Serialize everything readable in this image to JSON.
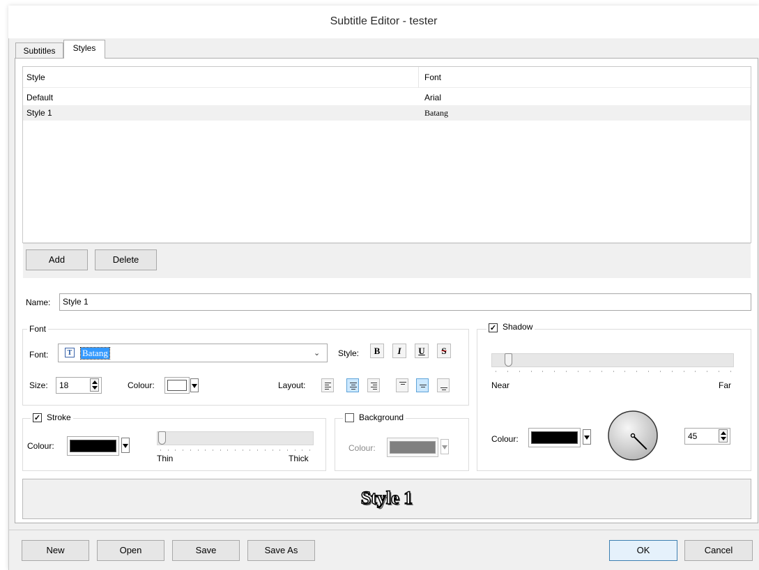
{
  "window": {
    "title": "Subtitle Editor - tester"
  },
  "tabs": [
    {
      "label": "Subtitles"
    },
    {
      "label": "Styles"
    }
  ],
  "styles_list": {
    "columns": [
      "Style",
      "Font"
    ],
    "rows": [
      {
        "style": "Default",
        "font": "Arial"
      },
      {
        "style": "Style 1",
        "font": "Batang"
      }
    ],
    "selected_row": 1
  },
  "list_buttons": {
    "add": "Add",
    "delete": "Delete"
  },
  "name": {
    "label": "Name:",
    "value": "Style 1"
  },
  "font_group": {
    "legend": "Font",
    "font_label": "Font:",
    "font_value": "Batang",
    "style_label": "Style:",
    "bold": "B",
    "italic": "I",
    "underline": "U",
    "strike": "S",
    "size_label": "Size:",
    "size_value": "18",
    "colour_label": "Colour:",
    "colour": "#ffffff",
    "layout_label": "Layout:"
  },
  "stroke_group": {
    "checked": true,
    "legend": "Stroke",
    "colour_label": "Colour:",
    "colour": "#000000",
    "slider_min": "Thin",
    "slider_max": "Thick",
    "slider_level": 0.0
  },
  "background_group": {
    "checked": false,
    "legend": "Background",
    "colour_label": "Colour:",
    "colour": "#808080"
  },
  "shadow_group": {
    "checked": true,
    "legend": "Shadow",
    "slider_min": "Near",
    "slider_max": "Far",
    "slider_level": 0.05,
    "colour_label": "Colour:",
    "colour": "#000000",
    "angle_value": "45"
  },
  "preview": {
    "text": "Style 1"
  },
  "footer": {
    "new": "New",
    "open": "Open",
    "save": "Save",
    "save_as": "Save As",
    "ok": "OK",
    "cancel": "Cancel"
  }
}
